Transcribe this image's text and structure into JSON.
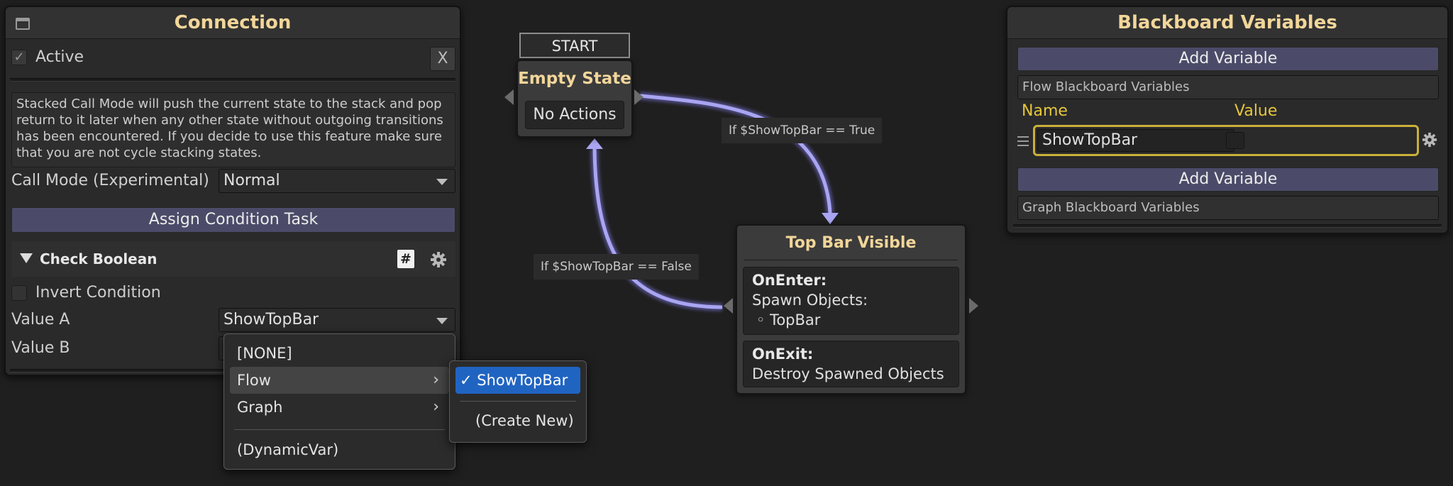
{
  "connection_panel": {
    "title": "Connection",
    "active_label": "Active",
    "close_label": "X",
    "info_text": "Stacked Call Mode will push the current state to the stack and pop return to it later when any other state without outgoing transitions has been encountered. If you decide to use this feature make sure that you are not cycle stacking states.",
    "call_mode_label": "Call Mode (Experimental)",
    "call_mode_value": "Normal",
    "assign_condition_label": "Assign Condition Task",
    "task_title": "Check Boolean",
    "hash_icon": "#",
    "invert_label": "Invert Condition",
    "value_a_label": "Value A",
    "value_a_value": "ShowTopBar",
    "value_b_label": "Value B"
  },
  "dropdown_menu": {
    "items": [
      "[NONE]",
      "Flow",
      "Graph",
      "(DynamicVar)"
    ]
  },
  "submenu": {
    "selected": "ShowTopBar",
    "create_new": "(Create New)"
  },
  "graph": {
    "start_label": "START",
    "empty_state": {
      "title": "Empty State",
      "body": "No Actions"
    },
    "top_bar_node": {
      "title": "Top Bar Visible",
      "on_enter_title": "OnEnter:",
      "on_enter_action": "Spawn Objects:",
      "on_enter_item": "◦ TopBar",
      "on_exit_title": "OnExit:",
      "on_exit_action": "Destroy Spawned Objects"
    },
    "edge_true": "If $ShowTopBar == True",
    "edge_false": "If $ShowTopBar == False",
    "edge_color": "#9a95e6"
  },
  "blackboard": {
    "title": "Blackboard Variables",
    "add_variable_label": "Add Variable",
    "flow_section": "Flow Blackboard Variables",
    "name_header": "Name",
    "value_header": "Value",
    "variable_name": "ShowTopBar",
    "graph_section": "Graph Blackboard Variables"
  },
  "colors": {
    "accent_title": "#f2d69a",
    "header_yellow": "#e5c63c",
    "selection_blue": "#2064c2",
    "button_purple": "#4b4b69"
  }
}
